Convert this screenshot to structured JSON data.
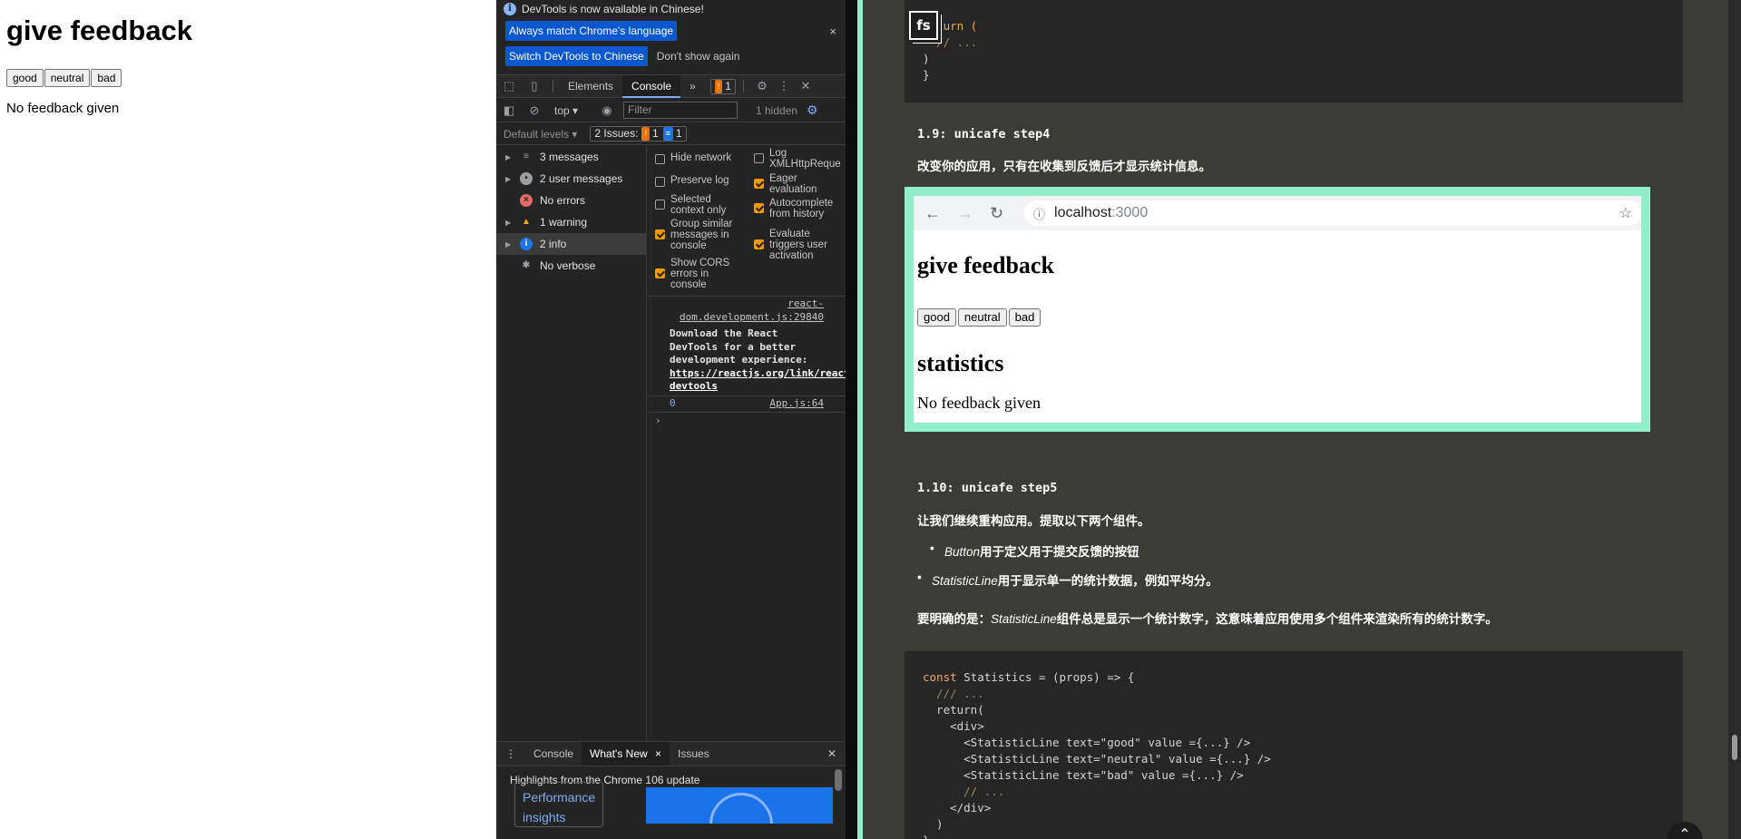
{
  "app": {
    "title": "give feedback",
    "buttons": [
      "good",
      "neutral",
      "bad"
    ],
    "status": "No feedback given"
  },
  "devtools": {
    "info_text": "DevTools is now available in Chinese!",
    "lang_btn_match": "Always match Chrome's language",
    "lang_btn_switch": "Switch DevTools to Chinese",
    "lang_btn_dismiss": "Don't show again",
    "close_glyph": "×",
    "tabs": [
      "Elements",
      "Console"
    ],
    "more_tabs": "»",
    "issue_badge_count": "1",
    "context": "top ▾",
    "filter_placeholder": "Filter",
    "hidden_count": "1 hidden",
    "default_levels": "Default levels ▾",
    "issues_label": "2 Issues:",
    "issues_warn": "1",
    "issues_info": "1",
    "sidebar": [
      {
        "label": "3 messages",
        "icon": "list-icon",
        "expandable": true
      },
      {
        "label": "2 user messages",
        "icon": "user-icon",
        "expandable": true
      },
      {
        "label": "No errors",
        "icon": "error-icon",
        "expandable": false
      },
      {
        "label": "1 warning",
        "icon": "warning-icon",
        "expandable": true
      },
      {
        "label": "2 info",
        "icon": "info-icon",
        "expandable": true
      },
      {
        "label": "No verbose",
        "icon": "verbose-icon",
        "expandable": false
      }
    ],
    "settings": {
      "hide_network": "Hide network",
      "preserve_log": "Preserve log",
      "selected_context": "Selected context only",
      "group_similar": "Group similar messages in console",
      "show_cors": "Show CORS errors in console",
      "log_xhr": "Log XMLHttpReque",
      "eager_eval": "Eager evaluation",
      "autocomplete": "Autocomplete from history",
      "evaluate_triggers": "Evaluate triggers user activation"
    },
    "log": {
      "source_link": "react-dom.development.js:29840",
      "message": "Download the React DevTools for a better development experience: ",
      "message_url": "https://reactjs.org/link/react-devtools",
      "value": "0",
      "value_source": "App.js:64",
      "prompt": "›"
    },
    "drawer": {
      "menu": "⋮",
      "tabs": [
        "Console",
        "What's New",
        "Issues"
      ],
      "highlights": "Highlights from the Chrome 106 update",
      "card_label": "Performance insights"
    }
  },
  "docs": {
    "logo": "fs",
    "code_top": [
      "return (",
      "  // ...",
      ")",
      "}"
    ],
    "section_19_title": "1.9: unicafe step4",
    "section_19_text": "改变你的应用，只有在收集到反馈后才显示统计信息。",
    "browser": {
      "url_host": "localhost",
      "url_port": ":3000",
      "title": "give feedback",
      "buttons": [
        "good",
        "neutral",
        "bad"
      ],
      "stats_title": "statistics",
      "status": "No feedback given"
    },
    "section_110_title": "1.10: unicafe step5",
    "section_110_intro": "让我们继续重构应用。提取以下两个组件。",
    "bullet1_name": "Button",
    "bullet1_text": "用于定义用于提交反馈的按钮",
    "bullet2_name": "StatisticLine",
    "bullet2_text": "用于显示单一的统计数据，例如平均分。",
    "note_prefix": "要明确的是：",
    "note_name": "StatisticLine",
    "note_text": "组件总是显示一个统计数字，这意味着应用使用多个组件来渲染所有的统计数字。",
    "code_lines": [
      "const Statistics = (props) => {",
      "  /// ...",
      "  return(",
      "    <div>",
      "      <StatisticLine text=\"good\" value ={...} />",
      "      <StatisticLine text=\"neutral\" value ={...} />",
      "      <StatisticLine text=\"bad\" value ={...} />",
      "      // ...",
      "    </div>",
      "  )",
      "}"
    ]
  }
}
